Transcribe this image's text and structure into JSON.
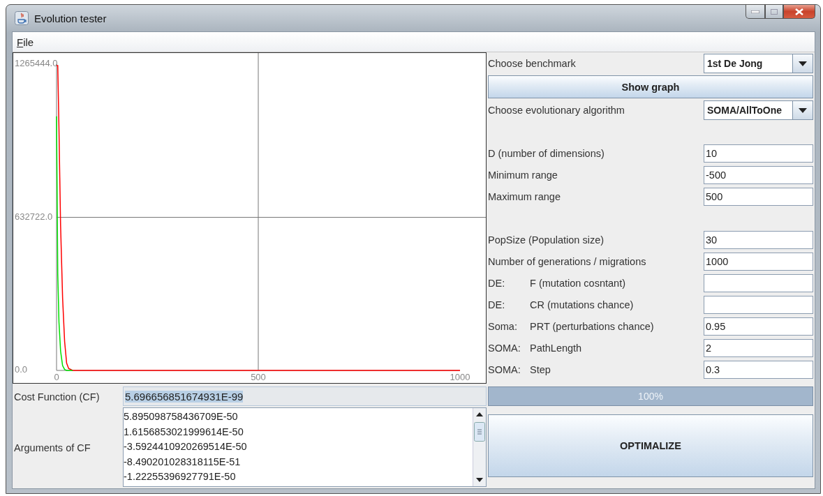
{
  "window": {
    "title": "Evolution tester"
  },
  "menu": [
    {
      "label": "File"
    }
  ],
  "chart": {
    "chart_data": {
      "type": "line",
      "x": [
        0,
        3,
        6,
        10,
        15,
        20,
        25,
        30,
        40,
        100,
        150,
        200,
        500,
        1000
      ],
      "series": [
        {
          "color": "#ff0000",
          "values": [
            1260000,
            1260000,
            1000000,
            600000,
            300000,
            120000,
            30000,
            8000,
            0,
            0,
            0,
            0,
            0,
            0
          ]
        },
        {
          "color": "#00e000",
          "values": [
            1050000,
            400000,
            200000,
            80000,
            20000,
            4000,
            0,
            0,
            0,
            null,
            null,
            null,
            null,
            null
          ]
        }
      ],
      "xlim": [
        0,
        1000
      ],
      "ylim": [
        0,
        1265444
      ],
      "xticks": [
        {
          "value": 0,
          "label": "0"
        },
        {
          "value": 500,
          "label": "500"
        },
        {
          "value": 1000,
          "label": "1000"
        }
      ],
      "yticks": [
        {
          "value": 0,
          "label": "0.0"
        },
        {
          "value": 632722,
          "label": "632722.0"
        },
        {
          "value": 1265444,
          "label": "1265444.0"
        }
      ]
    }
  },
  "benchmark": {
    "label": "Choose benchmark",
    "value": "1st De Jong"
  },
  "show_graph_button": "Show graph",
  "algorithm": {
    "label": "Choose evolutionary algorithm",
    "value": "SOMA/AllToOne"
  },
  "parameter_groups": [
    [
      {
        "label": "D (number of dimensions)",
        "value": "10"
      },
      {
        "label": "Minimum range",
        "value": "-500"
      },
      {
        "label": "Maximum range",
        "value": "500"
      }
    ],
    [
      {
        "label": "PopSize (Population size)",
        "value": "30"
      },
      {
        "label": "Number of generations / migrations",
        "value": "1000"
      },
      {
        "prefix": "DE:",
        "label": "F (mutation cosntant)"
      },
      {
        "prefix": "DE:",
        "label": "CR (mutations chance)"
      },
      {
        "prefix": "Soma:",
        "label": "PRT (perturbations chance)",
        "value": "0.95"
      },
      {
        "prefix": "SOMA:",
        "label": "PathLength",
        "value": "2"
      },
      {
        "prefix": "SOMA:",
        "label": "Step",
        "value": "0.3"
      }
    ]
  ],
  "cost_function": {
    "label": "Cost Function (CF)",
    "value": "5.696656851674931E-99",
    "highlighted": true
  },
  "progress": {
    "level": 1,
    "text": "100%"
  },
  "arguments": {
    "label": "Arguments of CF",
    "values": [
      "5.895098758436709E-50",
      "1.6156853021999614E-50",
      "-3.5924410920269514E-50",
      "-8.490201028318115E-51",
      "-1.22255396927791E-50"
    ]
  },
  "optimize_button": "OPTIMALIZE"
}
